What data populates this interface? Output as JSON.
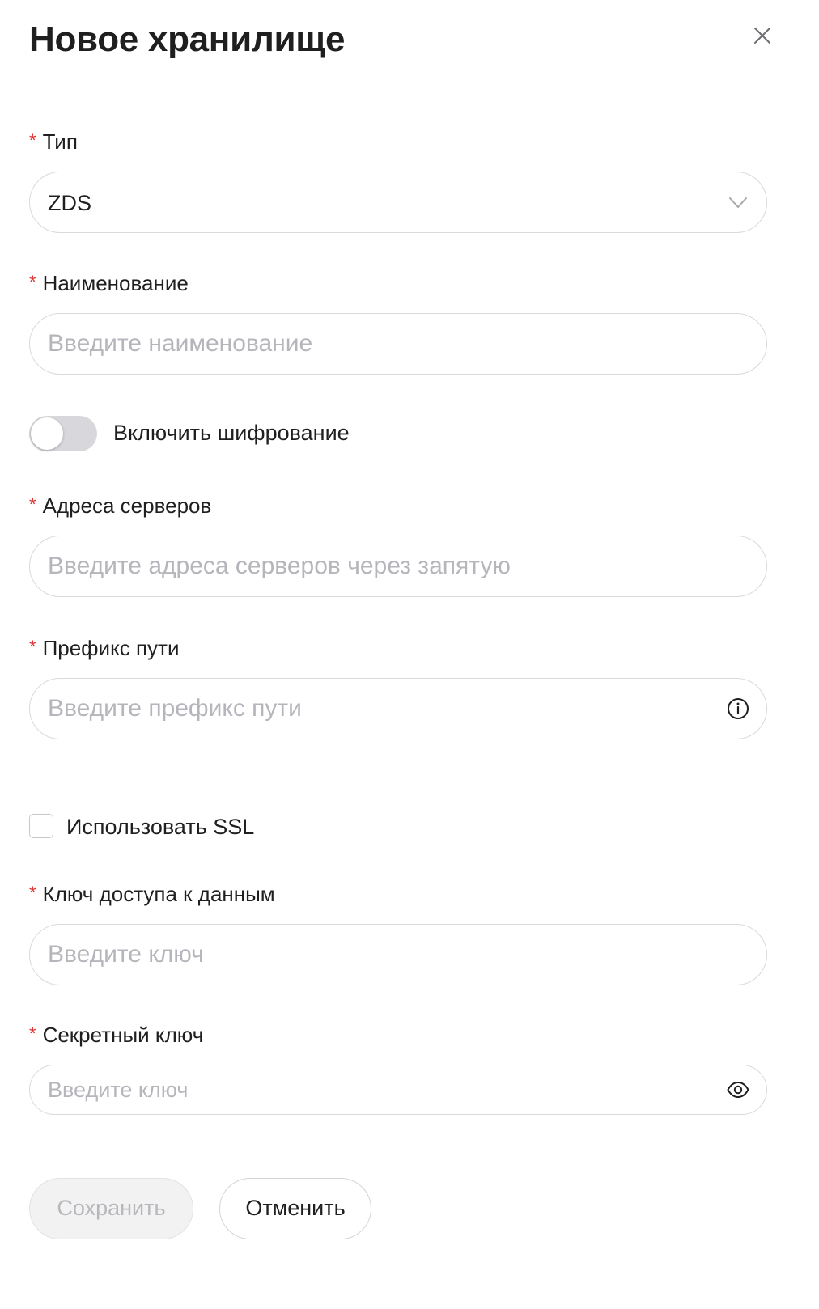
{
  "dialog": {
    "title": "Новое хранилище",
    "close_icon": "close-icon"
  },
  "fields": {
    "type": {
      "required_mark": "*",
      "label": "Тип",
      "value": "ZDS",
      "icon": "chevron-down-icon"
    },
    "name": {
      "required_mark": "*",
      "label": "Наименование",
      "placeholder": "Введите наименование",
      "value": ""
    },
    "encryption": {
      "label": "Включить шифрование",
      "enabled": false
    },
    "servers": {
      "required_mark": "*",
      "label": "Адреса серверов",
      "placeholder": "Введите адреса серверов через запятую",
      "value": ""
    },
    "path_prefix": {
      "required_mark": "*",
      "label": "Префикс пути",
      "placeholder": "Введите префикс пути",
      "value": "",
      "icon": "info-icon"
    },
    "ssl": {
      "label": "Использовать SSL",
      "checked": false
    },
    "access_key": {
      "required_mark": "*",
      "label": "Ключ доступа к данным",
      "placeholder": "Введите ключ",
      "value": ""
    },
    "secret_key": {
      "required_mark": "*",
      "label": "Секретный ключ",
      "placeholder": "Введите ключ",
      "value": "",
      "icon": "eye-icon"
    }
  },
  "actions": {
    "save_label": "Сохранить",
    "save_enabled": false,
    "cancel_label": "Отменить"
  },
  "colors": {
    "required": "#e0302f",
    "text": "#1f1f1f",
    "placeholder": "#b5b5bb",
    "border": "#d9d9de",
    "toggle_off": "#d8d8dc",
    "disabled_button_bg": "#f2f2f3"
  }
}
